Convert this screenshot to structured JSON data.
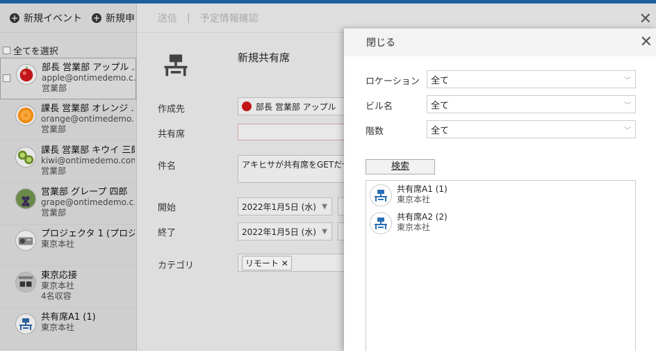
{
  "left": {
    "toolbar": {
      "new_event": "新規イベント",
      "new_request": "新規申"
    },
    "select_all": "全てを選択",
    "items": [
      {
        "name": "部長 営業部 アップル ...",
        "email": "apple@ontimedemo.c...",
        "dept": "営業部",
        "icon": "apple-avatar"
      },
      {
        "name": "課長 営業部 オレンジ ...",
        "email": "orange@ontimedemo...",
        "dept": "営業部",
        "icon": "orange-avatar"
      },
      {
        "name": "課長 営業部 キウイ 三郎",
        "email": "kiwi@ontimedemo.com",
        "dept": "営業部",
        "icon": "kiwi-avatar"
      },
      {
        "name": "営業部 グレープ 四郎",
        "email": "grape@ontimedemo.c...",
        "dept": "営業部",
        "icon": "grape-avatar"
      },
      {
        "name": "プロジェクタ 1 (プロジ...",
        "email": "東京本社",
        "dept": "",
        "icon": "projector-avatar"
      },
      {
        "name": "東京応接",
        "email": "東京本社",
        "dept": "4名収容",
        "icon": "room-avatar"
      },
      {
        "name": "共有席A1 (1)",
        "email": "東京本社",
        "dept": "",
        "icon": "desk-icon"
      }
    ]
  },
  "dialog": {
    "tab_send": "送信",
    "separator": "|",
    "tab_check": "予定情報確認",
    "title": "新規共有席",
    "labels": {
      "creator": "作成先",
      "seat": "共有席",
      "subject": "件名",
      "start": "開始",
      "end": "終了",
      "category": "カテゴリ"
    },
    "creator_value": "部長 営業部 アップル",
    "subject_value": "アキヒサが共有席をGETだぜ",
    "start_date": "2022年1月5日 (水)",
    "end_date": "2022年1月5日 (水)",
    "category_tag": "リモート"
  },
  "panel": {
    "close_label": "閉じる",
    "location_label": "ロケーション",
    "location_value": "全て",
    "building_label": "ビル名",
    "building_value": "全て",
    "floor_label": "階数",
    "floor_value": "全て",
    "search_label": "検索",
    "results": [
      {
        "name": "共有席A1 (1)",
        "location": "東京本社"
      },
      {
        "name": "共有席A2 (2)",
        "location": "東京本社"
      }
    ]
  },
  "colors": {
    "accent": "#1e5f9e"
  }
}
